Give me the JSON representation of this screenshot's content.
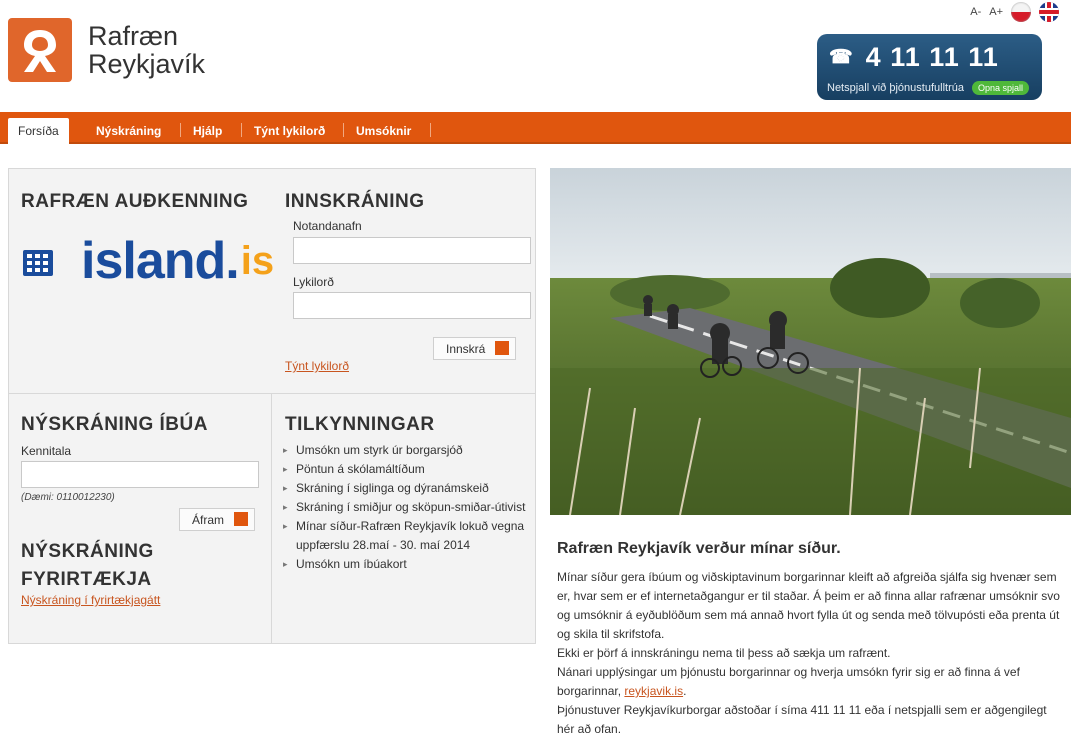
{
  "header": {
    "logo_line1": "Rafræn",
    "logo_line2": "Reykjavík",
    "font_decrease": "A-",
    "font_increase": "A+",
    "phone_number": "4 11 11 11",
    "chat_text": "Netspjall við þjónustufulltrúa",
    "chat_button": "Opna spjall"
  },
  "nav": {
    "items": [
      "Forsíða",
      "Nýskráning",
      "Hjálp",
      "Týnt lykilorð",
      "Umsóknir"
    ]
  },
  "auth": {
    "title": "RAFRÆN AUÐKENNING",
    "logo_text": "island.",
    "logo_suffix": "is"
  },
  "login": {
    "title": "INNSKRÁNING",
    "username_label": "Notandanafn",
    "username_value": "",
    "password_label": "Lykilorð",
    "password_value": "",
    "submit_label": "Innskrá",
    "forgot_link": "Týnt lykilorð"
  },
  "resident": {
    "title": "NÝSKRÁNING ÍBÚA",
    "kennitala_label": "Kennitala",
    "kennitala_value": "",
    "example": "(Dæmi: 0110012230)",
    "continue_label": "Áfram"
  },
  "company": {
    "title_line1": "NÝSKRÁNING",
    "title_line2": "FYRIRTÆKJA",
    "link": "Nýskráning í fyrirtækjagátt"
  },
  "notices": {
    "title": "TILKYNNINGAR",
    "items": [
      "Umsókn um styrk úr borgarsjóð",
      "Pöntun á skólamáltíðum",
      "Skráning í siglinga og dýranámskeið",
      "Skráning í smiðjur og sköpun-smiðar-útivist",
      "Mínar síður-Rafræn Reykjavík lokuð vegna uppfærslu 28.maí - 30. maí 2014",
      "Umsókn um íbúakort"
    ]
  },
  "article": {
    "title": "Rafræn Reykjavík verður mínar síður.",
    "p1": "Mínar síður gera íbúum og viðskiptavinum borgarinnar kleift að afgreiða sjálfa sig hvenær sem er, hvar sem er ef internetaðgangur er til staðar. Á þeim er að finna allar rafrænar umsóknir svo og umsóknir á eyðublöðum sem má annað hvort fylla út og senda með tölvupósti eða prenta út og skila til skrifstofa.",
    "p2": "Ekki er þörf á innskráningu nema til þess að sækja um rafrænt.",
    "p3_before": "Nánari upplýsingar um þjónustu borgarinnar og hverja umsókn fyrir sig er að finna á vef borgarinnar,",
    "p3_link": "reykjavik.is",
    "p3_after": ".",
    "p4": "Þjónustuver Reykjavíkurborgar aðstoðar í síma 411 11 11 eða í netspjalli sem er aðgengilegt hér að ofan."
  },
  "colors": {
    "brand_orange": "#e0560e",
    "phone_blue": "#1f4b72",
    "chat_green": "#4fb83a",
    "island_blue": "#1a4c9c"
  }
}
